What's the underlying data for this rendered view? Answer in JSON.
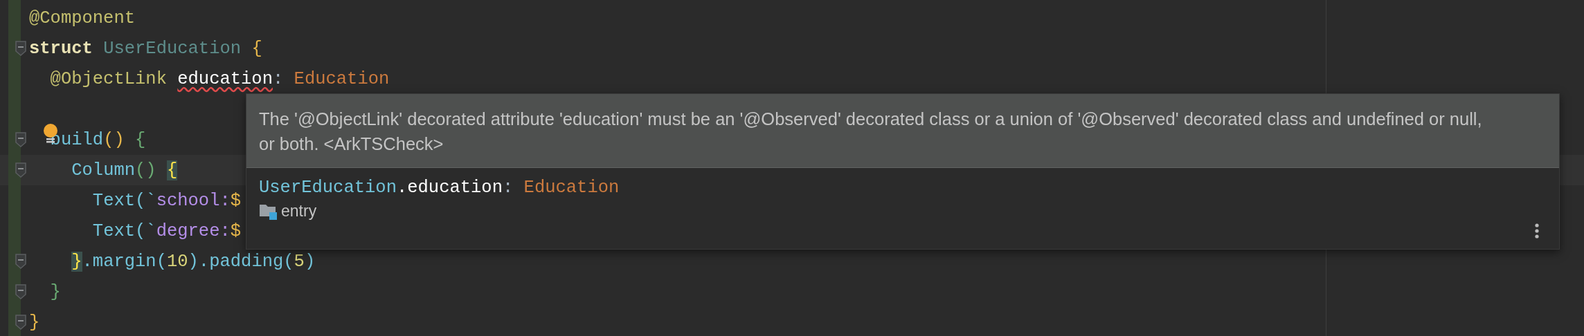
{
  "editor": {
    "lines": [
      {
        "tokens": [
          {
            "kind": "annotation",
            "text": "@Component"
          }
        ]
      },
      {
        "fold": true,
        "tokens": [
          {
            "kind": "keyword",
            "text": "struct"
          },
          {
            "kind": "classname",
            "text": " UserEducation"
          },
          {
            "kind": "brace",
            "text": " {"
          }
        ]
      },
      {
        "tokens": [
          {
            "kind": "annotation",
            "text": "  @ObjectLink"
          },
          {
            "kind": "field",
            "text": " education",
            "error": true
          },
          {
            "kind": "plain",
            "text": ":"
          },
          {
            "kind": "type",
            "text": " Education"
          }
        ]
      },
      {
        "blank": true
      },
      {
        "fold": true,
        "bulb": true,
        "tokens": [
          {
            "kind": "fn",
            "text": "  build"
          },
          {
            "kind": "paren",
            "text": "()"
          },
          {
            "kind": "green",
            "text": " {"
          }
        ]
      },
      {
        "fold": true,
        "current": true,
        "tokens": [
          {
            "kind": "fn",
            "text": "    Column"
          },
          {
            "kind": "green",
            "text": "()"
          },
          {
            "kind": "match",
            "text": " {"
          }
        ]
      },
      {
        "tokens": [
          {
            "kind": "fn",
            "text": "      Text(`"
          },
          {
            "kind": "string",
            "text": "school:"
          },
          {
            "kind": "brace",
            "text": "$"
          }
        ]
      },
      {
        "tokens": [
          {
            "kind": "fn",
            "text": "      Text(`"
          },
          {
            "kind": "string",
            "text": "degree:"
          },
          {
            "kind": "brace",
            "text": "$"
          }
        ]
      },
      {
        "fold": true,
        "tokens": [
          {
            "kind": "match",
            "text": "    }"
          },
          {
            "kind": "fn",
            "text": ".margin("
          },
          {
            "kind": "number",
            "text": "10"
          },
          {
            "kind": "fn",
            "text": ").padding("
          },
          {
            "kind": "number",
            "text": "5"
          },
          {
            "kind": "fn",
            "text": ")"
          }
        ]
      },
      {
        "fold": true,
        "tokens": [
          {
            "kind": "green",
            "text": "  }"
          }
        ]
      },
      {
        "fold": true,
        "tokens": [
          {
            "kind": "brace",
            "text": "}"
          }
        ]
      }
    ]
  },
  "tooltip": {
    "message": "The '@ObjectLink' decorated attribute 'education' must be an '@Observed' decorated class or a union of '@Observed' decorated class and undefined or null, or both. <ArkTSCheck>",
    "signature": [
      {
        "kind": "fn",
        "text": "UserEducation"
      },
      {
        "kind": "field",
        "text": ".education"
      },
      {
        "kind": "plain",
        "text": ": "
      },
      {
        "kind": "type",
        "text": "Education"
      }
    ],
    "location": "entry"
  }
}
